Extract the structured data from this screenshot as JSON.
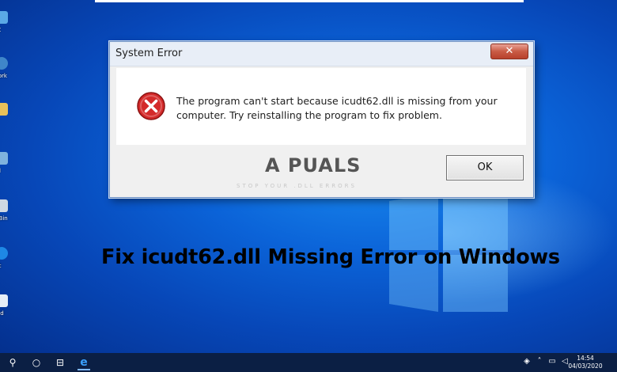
{
  "dialog": {
    "title": "System Error",
    "close_label": "✕",
    "message_line1": "The program can't start because icudt62.dll is missing from your",
    "message_line2": "computer. Try reinstalling the program to fix problem.",
    "ok_label": "OK",
    "watermark": "A PUALS",
    "watermark_tagline": "STOP YOUR .DLL ERRORS"
  },
  "headline": "Fix icudt62.dll Missing Error on Windows",
  "desktop_icons": [
    {
      "label": "PC"
    },
    {
      "label": "work"
    },
    {
      "label": "rt"
    },
    {
      "label": "rol"
    },
    {
      "label": "e Bin"
    },
    {
      "label": "oft"
    },
    {
      "label": "Pad"
    }
  ],
  "taskbar": {
    "time": "14:54",
    "date": "04/03/2020"
  },
  "colors": {
    "desktop": "#0b63d8",
    "taskbar": "#0b1f44",
    "close_button": "#c95b45",
    "error_red": "#d42a2a"
  }
}
